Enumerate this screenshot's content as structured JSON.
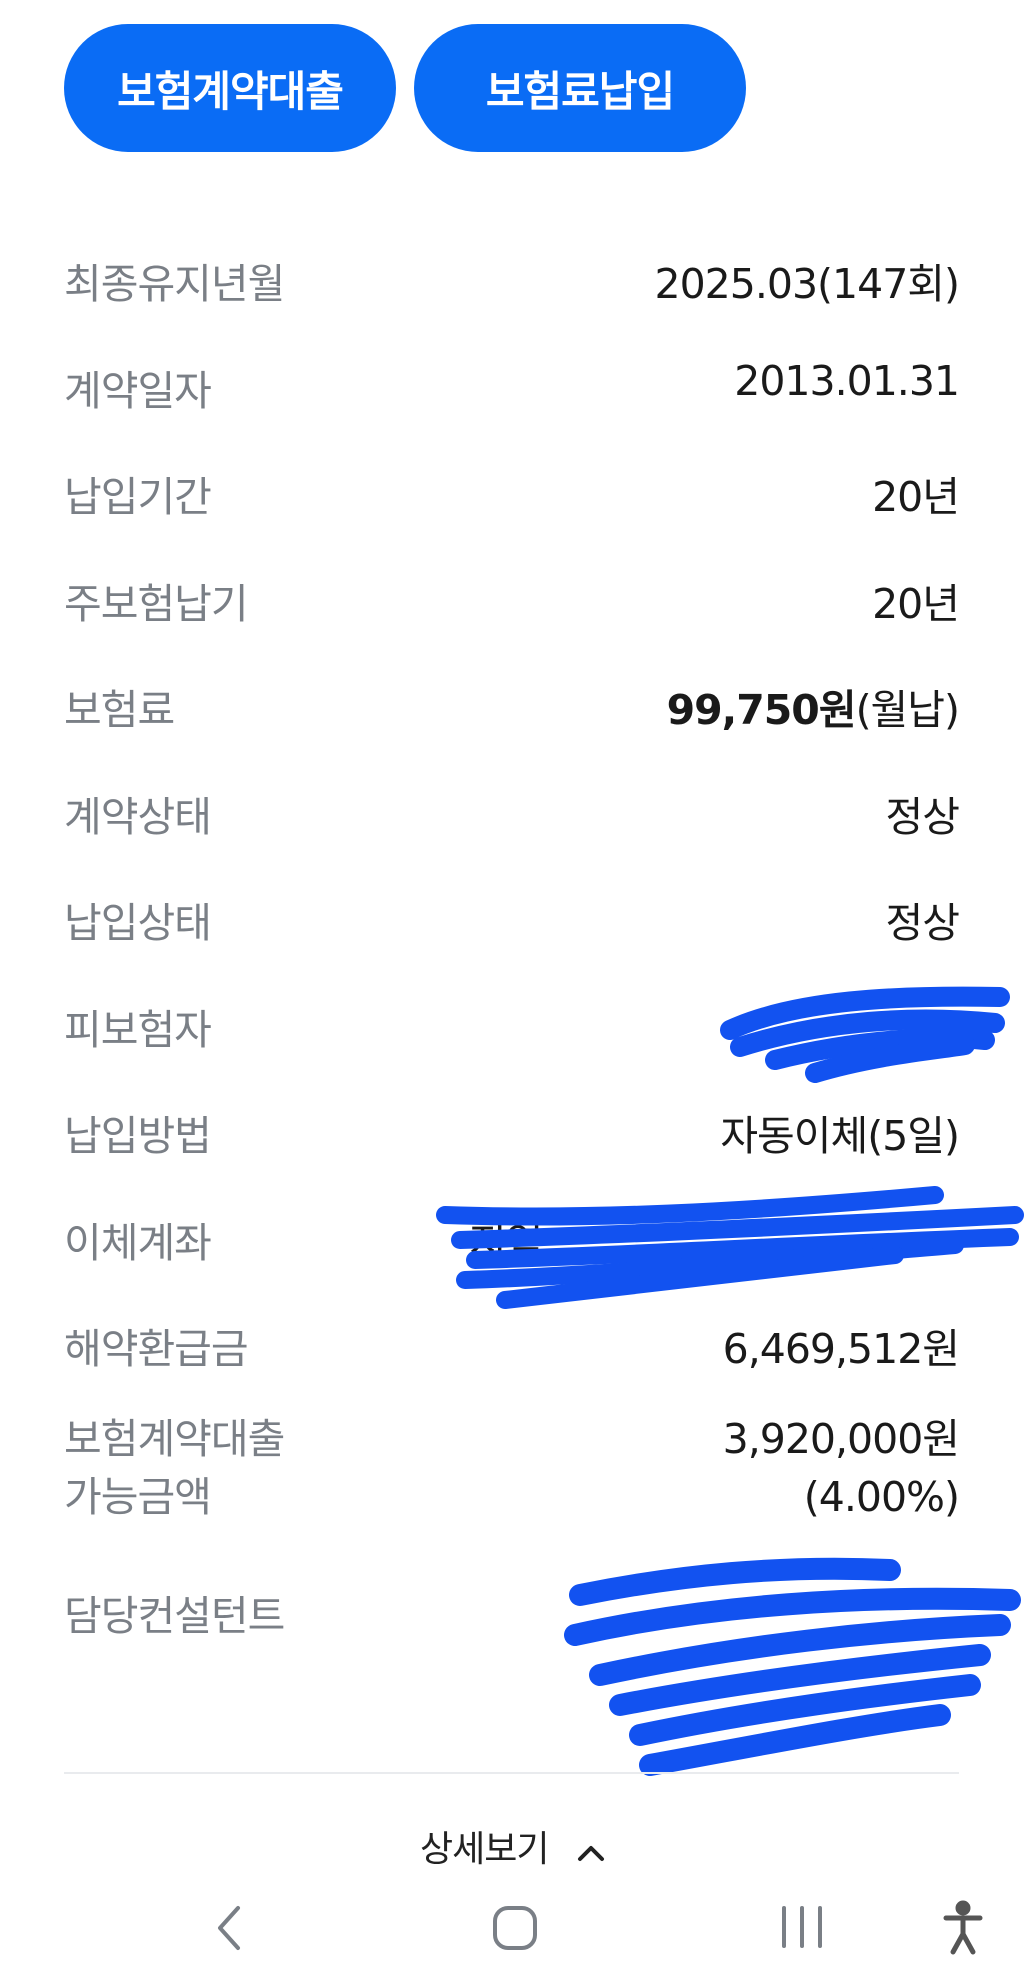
{
  "buttons": {
    "loan": "보험계약대출",
    "premium_payment": "보험료납입"
  },
  "details": {
    "last_maintained_label": "최종유지년월",
    "last_maintained_value": "2025.03(147회)",
    "contract_date_label": "계약일자",
    "contract_date_value": "2013.01.31",
    "payment_period_label": "납입기간",
    "payment_period_value": "20년",
    "main_payment_label": "주보험납기",
    "main_payment_value": "20년",
    "premium_label": "보험료",
    "premium_amount": "99,750원",
    "premium_cycle": "(월납)",
    "contract_status_label": "계약상태",
    "contract_status_value": "정상",
    "payment_status_label": "납입상태",
    "payment_status_value": "정상",
    "insured_label": "피보험자",
    "payment_method_label": "납입방법",
    "payment_method_value": "자동이체(5일)",
    "transfer_account_label": "이체계좌",
    "transfer_account_visible": "지역",
    "surrender_label": "해약환급금",
    "surrender_value": "6,469,512원",
    "loan_available_label_1": "보험계약대출",
    "loan_available_label_2": "가능금액",
    "loan_available_value": "3,920,000원",
    "loan_available_rate": "(4.00%)",
    "consultant_label": "담당컨설턴트"
  },
  "footer": {
    "detail_toggle": "상세보기"
  },
  "icons": {
    "detail_chevron": "chevron-up-icon",
    "nav_back": "back-icon",
    "nav_home": "home-icon",
    "nav_recents": "recents-icon",
    "nav_accessibility": "accessibility-icon"
  },
  "colors": {
    "primary": "#0a6cf5",
    "label_gray": "#7a7f86",
    "redaction": "#1252f0"
  }
}
